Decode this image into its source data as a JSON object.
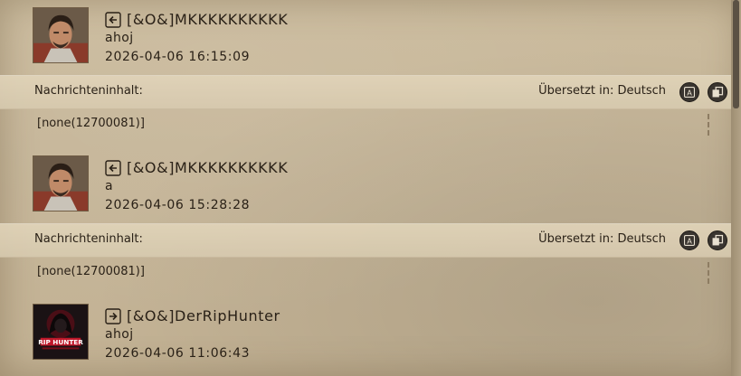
{
  "messages": [
    {
      "sender": "[&O&]MKKKKKKKKKK",
      "direction_icon": "arrow-in-icon",
      "text": "ahoj",
      "time": "2026-04-06 16:15:09",
      "content_label": "Nachrichteninhalt:",
      "translated_label": "Übersetzt in: Deutsch",
      "content": "[none(12700081)]"
    },
    {
      "sender": "[&O&]MKKKKKKKKKK",
      "direction_icon": "arrow-in-icon",
      "text": "a",
      "time": "2026-04-06 15:28:28",
      "content_label": "Nachrichteninhalt:",
      "translated_label": "Übersetzt in: Deutsch",
      "content": "[none(12700081)]"
    },
    {
      "sender": "[&O&]DerRipHunter",
      "direction_icon": "arrow-out-icon",
      "text": "ahoj",
      "time": "2026-04-06 11:06:43",
      "avatar_logo_text": "RIP HUNTER"
    }
  ],
  "colors": {
    "parchment": "#c6b699",
    "band": "#ddd0b4",
    "text": "#2a2117",
    "button": "#3a3530",
    "riphunter_red": "#c0182a"
  }
}
